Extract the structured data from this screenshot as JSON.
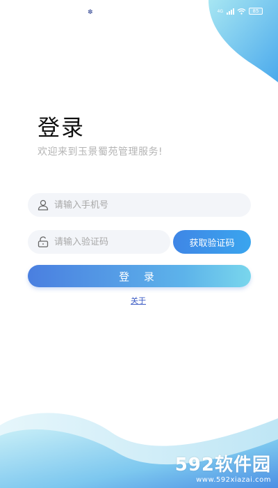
{
  "status_bar": {
    "indicator": "✽",
    "network": "4G",
    "battery": "85"
  },
  "login": {
    "title": "登录",
    "subtitle": "欢迎来到玉景蜀苑管理服务!",
    "phone_placeholder": "请输入手机号",
    "code_placeholder": "请输入验证码",
    "get_code_label": "获取验证码",
    "submit_label": "登 录",
    "about_label": "关于"
  },
  "watermark": {
    "logo": "592软件园",
    "url": "www.592xiazai.com"
  },
  "colors": {
    "accent": "#3f86e6",
    "accent_light": "#79d6ec",
    "field_bg": "#f3f5f9",
    "subtitle": "#b4b4b4",
    "link": "#3b5bc4"
  },
  "icons": {
    "phone_field": "user-icon",
    "code_field": "lock-icon"
  }
}
